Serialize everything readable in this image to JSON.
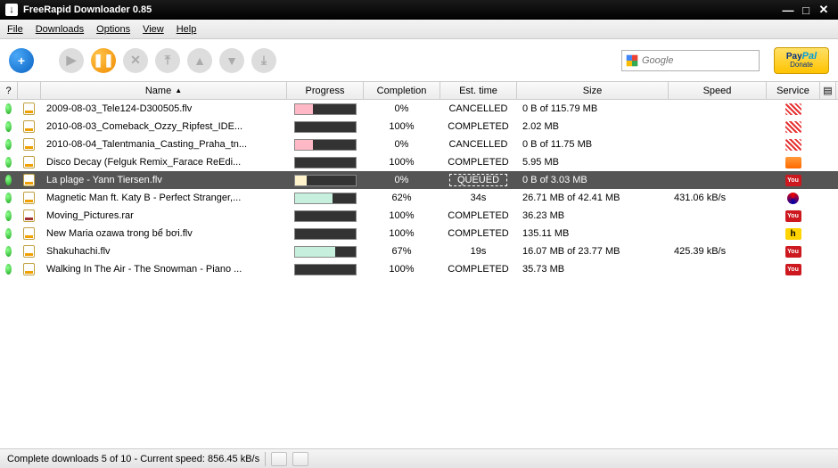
{
  "title": "FreeRapid Downloader 0.85",
  "menu": {
    "file": "File",
    "downloads": "Downloads",
    "options": "Options",
    "view": "View",
    "help": "Help"
  },
  "search": {
    "placeholder": "Google"
  },
  "paypal": {
    "brand": "PayPal",
    "sub": "Donate"
  },
  "columns": {
    "q": "?",
    "name": "Name",
    "progress": "Progress",
    "completion": "Completion",
    "est": "Est. time",
    "size": "Size",
    "speed": "Speed",
    "service": "Service"
  },
  "rows": [
    {
      "name": "2009-08-03_Tele124-D300505.flv",
      "prog_pct": 30,
      "prog_cls": "pf-pink",
      "completion": "0%",
      "est": "CANCELLED",
      "size": "0 B of 115.79 MB",
      "speed": "",
      "service": "blocked",
      "ftype": "file"
    },
    {
      "name": "2010-08-03_Comeback_Ozzy_Ripfest_IDE...",
      "prog_pct": 100,
      "prog_cls": "",
      "completion": "100%",
      "est": "COMPLETED",
      "size": "2.02 MB",
      "speed": "",
      "service": "blocked",
      "ftype": "file"
    },
    {
      "name": "2010-08-04_Talentmania_Casting_Praha_tn...",
      "prog_pct": 30,
      "prog_cls": "pf-pink",
      "completion": "0%",
      "est": "CANCELLED",
      "size": "0 B of 11.75 MB",
      "speed": "",
      "service": "blocked",
      "ftype": "file"
    },
    {
      "name": "Disco Decay (Felguk Remix_Farace ReEdi...",
      "prog_pct": 100,
      "prog_cls": "",
      "completion": "100%",
      "est": "COMPLETED",
      "size": "5.95 MB",
      "speed": "",
      "service": "sc",
      "ftype": "file"
    },
    {
      "name": "La plage - Yann Tiersen.flv",
      "prog_pct": 20,
      "prog_cls": "pf-cream",
      "completion": "0%",
      "est": "QUEUED",
      "size": "0 B of 3.03 MB",
      "speed": "",
      "service": "yt",
      "ftype": "file",
      "selected": true,
      "boxed_est": true
    },
    {
      "name": "Magnetic Man ft. Katy B - Perfect Stranger,...",
      "prog_pct": 62,
      "prog_cls": "pf-mint",
      "completion": "62%",
      "est": "34s",
      "size": "26.71 MB of 42.41 MB",
      "speed": "431.06 kB/s",
      "service": "swirl",
      "ftype": "file"
    },
    {
      "name": "Moving_Pictures.rar",
      "prog_pct": 100,
      "prog_cls": "",
      "completion": "100%",
      "est": "COMPLETED",
      "size": "36.23 MB",
      "speed": "",
      "service": "yt",
      "ftype": "rar"
    },
    {
      "name": "New Maria ozawa trong bể bơi.flv",
      "prog_pct": 100,
      "prog_cls": "",
      "completion": "100%",
      "est": "COMPLETED",
      "size": "135.11 MB",
      "speed": "",
      "service": "hf",
      "ftype": "file"
    },
    {
      "name": "Shakuhachi.flv",
      "prog_pct": 67,
      "prog_cls": "pf-mint",
      "completion": "67%",
      "est": "19s",
      "size": "16.07 MB of 23.77 MB",
      "speed": "425.39 kB/s",
      "service": "yt",
      "ftype": "file"
    },
    {
      "name": "Walking In The Air - The Snowman - Piano ...",
      "prog_pct": 100,
      "prog_cls": "",
      "completion": "100%",
      "est": "COMPLETED",
      "size": "35.73 MB",
      "speed": "",
      "service": "yt",
      "ftype": "file"
    }
  ],
  "status": "Complete downloads 5 of 10 - Current speed: 856.45 kB/s"
}
